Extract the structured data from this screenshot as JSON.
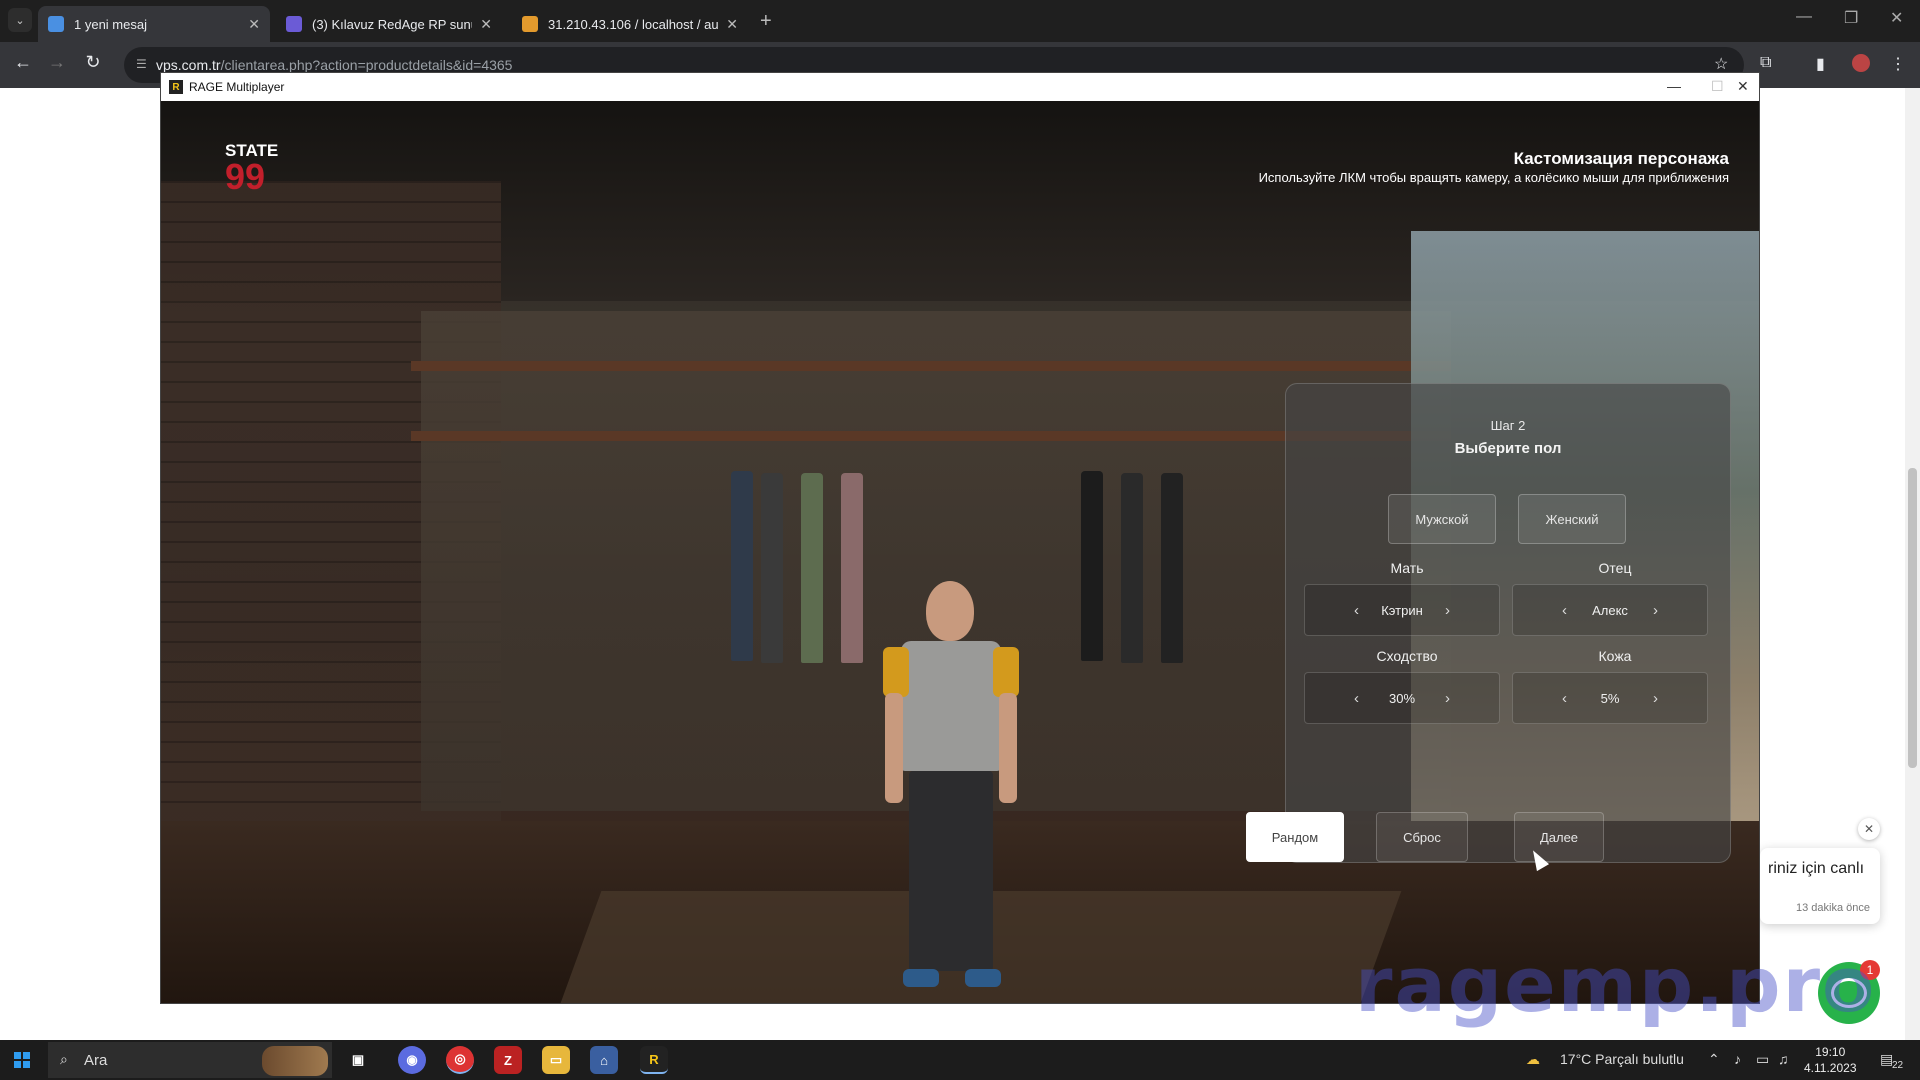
{
  "browser": {
    "tabs": [
      {
        "title": "1 yeni mesaj",
        "active": true,
        "favicon_color": "#4a90e2"
      },
      {
        "title": "(3) Kılavuz RedAge RP sunucu",
        "active": false,
        "favicon_color": "#6b5bd6"
      },
      {
        "title": "31.210.43.106 / localhost / auto",
        "active": false,
        "favicon_color": "#e39a2d"
      }
    ],
    "url_host": "vps.com.tr",
    "url_path": "/clientarea.php?action=productdetails&id=4365"
  },
  "game_window": {
    "title": "RAGE Multiplayer",
    "logo": {
      "top": "STATE",
      "num": "99"
    },
    "header": {
      "title": "Кастомизация персонажа",
      "subtitle": "Используйте ЛКМ чтобы вращять камеру, а колёсико мыши для приближения"
    },
    "panel": {
      "step": "Шаг 2",
      "choose": "Выберите пол",
      "gender_buttons": [
        "Мужской",
        "Женский"
      ],
      "mother_label": "Мать",
      "mother_value": "Кэтрин",
      "father_label": "Отец",
      "father_value": "Алекс",
      "similarity_label": "Сходство",
      "similarity_value": "30%",
      "skin_label": "Кожа",
      "skin_value": "5%",
      "actions": {
        "random": "Рандом",
        "reset": "Сброс",
        "next": "Далее"
      }
    }
  },
  "chat_widget": {
    "text": "riniz için canlı",
    "time": "13 dakika önce",
    "badge": "1"
  },
  "watermark": "ragemp.pro",
  "taskbar": {
    "search_placeholder": "Ara",
    "weather": "17°C  Parçalı bulutlu",
    "time": "19:10",
    "date": "4.11.2023",
    "notifications": "22"
  }
}
